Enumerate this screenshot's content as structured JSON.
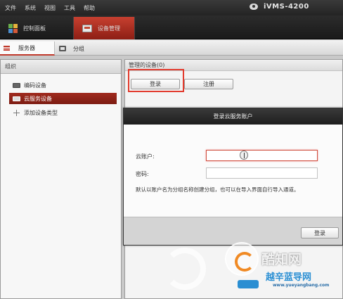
{
  "menubar": {
    "items": [
      "文件",
      "系统",
      "视图",
      "工具",
      "帮助"
    ],
    "app_title": "iVMS-4200"
  },
  "modules": {
    "control_panel": "控制面板",
    "device_management": "设备管理"
  },
  "subtabs": {
    "server": "服务器",
    "group": "分组"
  },
  "left_panel": {
    "title": "组织",
    "items": [
      "编码设备",
      "云服务设备",
      "添加设备类型"
    ]
  },
  "right_panel": {
    "title": "管理的设备(0)",
    "login_button": "登录",
    "register_button": "注册"
  },
  "dialog": {
    "title": "登录云服务账户",
    "account_label": "云账户:",
    "password_label": "密码:",
    "hint": "默认以账户名为分组名称创建分组，也可以在导入界面自行导入通道。",
    "login_button": "登录"
  },
  "watermark": {
    "brand": "酷知网",
    "site_name": "越辛蓝导网",
    "site_url": "www.yueyangbang.com"
  },
  "colors": {
    "accent_red": "#c0392b",
    "highlight_red": "#e23b2e",
    "dark_bar": "#242424"
  }
}
